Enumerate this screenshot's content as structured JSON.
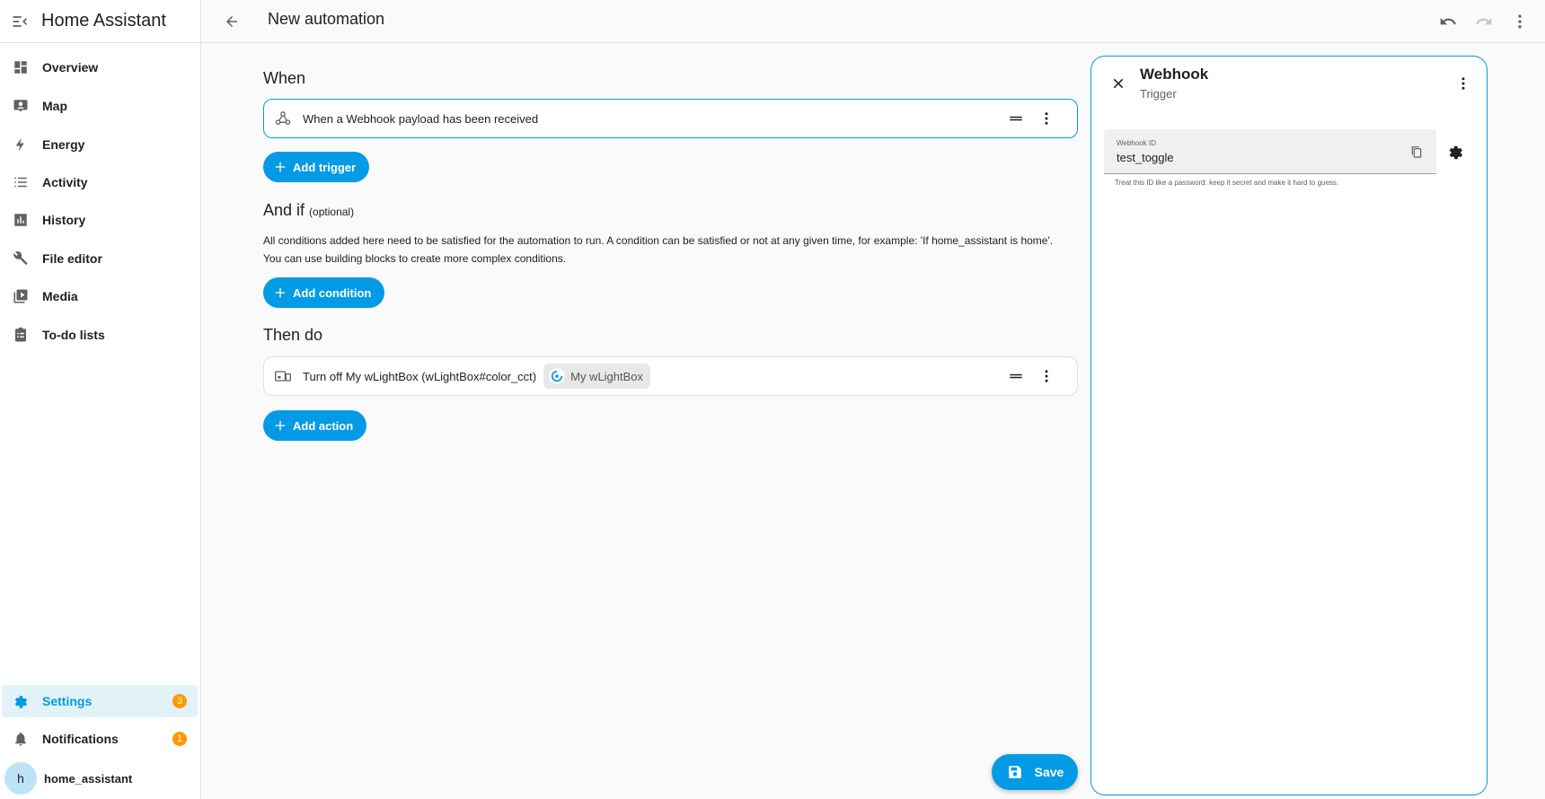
{
  "sidebar": {
    "app_title": "Home Assistant",
    "items": [
      {
        "label": "Overview",
        "icon": "dashboard-icon"
      },
      {
        "label": "Map",
        "icon": "map-person-icon"
      },
      {
        "label": "Energy",
        "icon": "lightning-bolt-icon"
      },
      {
        "label": "Activity",
        "icon": "list-icon"
      },
      {
        "label": "History",
        "icon": "chart-bar-icon"
      },
      {
        "label": "File editor",
        "icon": "wrench-icon"
      },
      {
        "label": "Media",
        "icon": "media-play-icon"
      },
      {
        "label": "To-do lists",
        "icon": "clipboard-list-icon"
      }
    ],
    "settings": {
      "label": "Settings",
      "badge": "3"
    },
    "notifications": {
      "label": "Notifications",
      "badge": "1"
    },
    "user": {
      "initial": "h",
      "name": "home_assistant"
    }
  },
  "topbar": {
    "title": "New automation"
  },
  "main": {
    "when": {
      "heading": "When",
      "trigger_text": "When a Webhook payload has been received",
      "add_label": "Add trigger"
    },
    "and_if": {
      "heading": "And if",
      "optional": "(optional)",
      "description": "All conditions added here need to be satisfied for the automation to run. A condition can be satisfied or not at any given time, for example: 'If home_assistant is home'. You can use building blocks to create more complex conditions.",
      "add_label": "Add condition"
    },
    "then_do": {
      "heading": "Then do",
      "action_text": "Turn off My wLightBox (wLightBox#color_cct)",
      "chip_label": "My wLightBox",
      "add_label": "Add action"
    },
    "save_label": "Save"
  },
  "panel": {
    "title": "Webhook",
    "subtitle": "Trigger",
    "field_label": "Webhook ID",
    "field_value": "test_toggle",
    "helper": "Treat this ID like a password: keep it secret and make it hard to guess."
  },
  "colors": {
    "accent": "#039be5",
    "badge": "#ff9800",
    "active_bg": "#e1f2f9"
  }
}
